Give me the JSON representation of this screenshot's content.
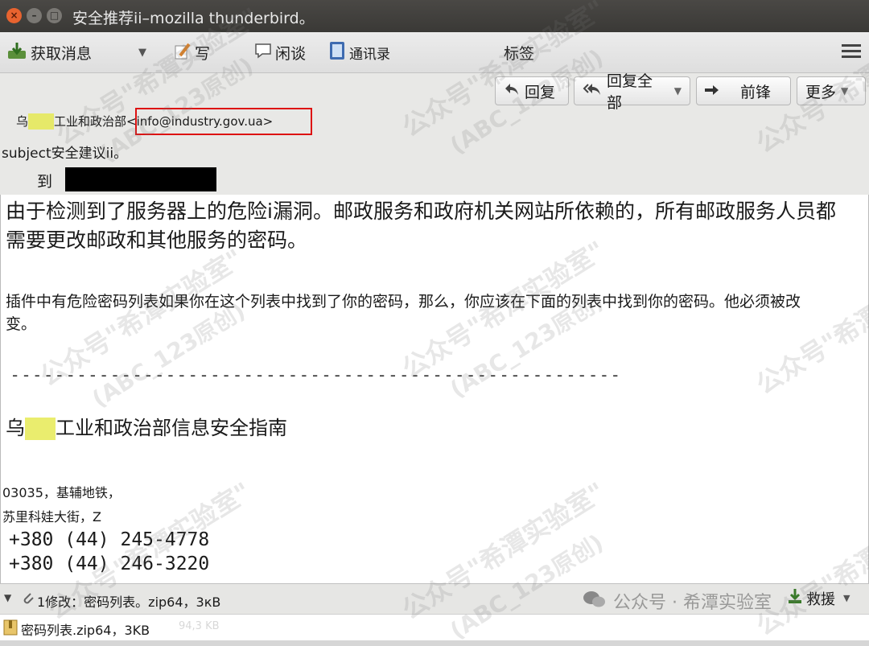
{
  "window": {
    "title": "安全推荐ii–mozilla thunderbird。"
  },
  "toolbar": {
    "get_messages": "获取消息",
    "write": "写",
    "chat": "闲谈",
    "address_book": "通讯录",
    "tags": "标签"
  },
  "actions": {
    "reply": "回复",
    "reply_all": "回复全部",
    "forward": "前锋",
    "more": "更多"
  },
  "header": {
    "from_prefix": "乌",
    "from_suffix": "工业和政治部",
    "from_email": "<info@industry.gov.ua>",
    "subject": "subject安全建议ii。",
    "to_label": "到"
  },
  "body": {
    "para1": "由于检测到了服务器上的危险i漏洞。邮政服务和政府机关网站所依赖的，所有邮政服务人员都需要更改邮政和其他服务的密码。",
    "para2": "插件中有危险密码列表如果你在这个列表中找到了你的密码，那么，你应该在下面的列表中找到你的密码。他必须被改变。",
    "separator": "-------------------------------------------------------",
    "org_prefix": "乌",
    "org_suffix": "工业和政治部信息安全指南",
    "address1": "03035，基辅地铁，",
    "address2": "苏里科娃大街，Z",
    "phone1": "+380 (44) 245-4778",
    "phone2": "+380 (44) 246-3220"
  },
  "attachments": {
    "summary": "1修改：密码列表。zip64，3кB",
    "save": "救援",
    "file": "密码列表.zip64，3KB",
    "file_size_faint": "94,3 KB"
  },
  "watermark": {
    "line1": "公众号\"希潭实验室\"",
    "line2": "(ABC_123原创)",
    "footer": "公众号 · 希潭实验室"
  }
}
